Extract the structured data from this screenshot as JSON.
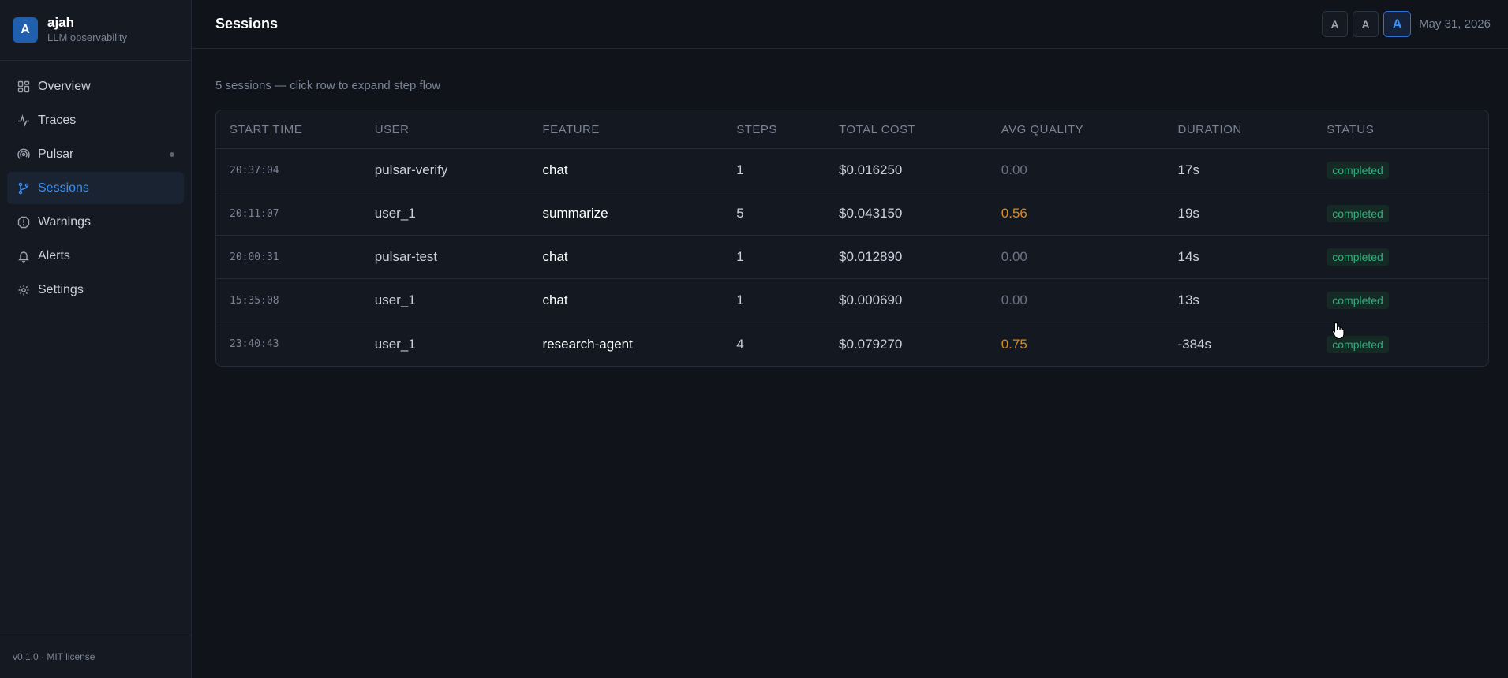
{
  "brand": {
    "initial": "A",
    "name": "ajah",
    "subtitle": "LLM observability"
  },
  "sidebar": {
    "items": [
      {
        "label": "Overview",
        "icon": "grid-icon"
      },
      {
        "label": "Traces",
        "icon": "activity-icon"
      },
      {
        "label": "Pulsar",
        "icon": "radar-icon"
      },
      {
        "label": "Sessions",
        "icon": "branch-icon",
        "active": true
      },
      {
        "label": "Warnings",
        "icon": "octagon-alert-icon"
      },
      {
        "label": "Alerts",
        "icon": "bell-icon"
      },
      {
        "label": "Settings",
        "icon": "gear-icon"
      }
    ],
    "footer": "v0.1.0 · MIT license"
  },
  "header": {
    "title": "Sessions",
    "font_buttons": [
      "A",
      "A",
      "A"
    ],
    "date": "May 31, 2026"
  },
  "main": {
    "summary": "5 sessions — click row to expand step flow",
    "columns": [
      "START TIME",
      "USER",
      "FEATURE",
      "STEPS",
      "TOTAL COST",
      "AVG QUALITY",
      "DURATION",
      "STATUS"
    ],
    "rows": [
      {
        "start": "20:37:04",
        "user": "pulsar-verify",
        "feature": "chat",
        "steps": "1",
        "cost": "$0.016250",
        "quality": "0.00",
        "duration": "17s",
        "status": "completed"
      },
      {
        "start": "20:11:07",
        "user": "user_1",
        "feature": "summarize",
        "steps": "5",
        "cost": "$0.043150",
        "quality": "0.56",
        "duration": "19s",
        "status": "completed"
      },
      {
        "start": "20:00:31",
        "user": "pulsar-test",
        "feature": "chat",
        "steps": "1",
        "cost": "$0.012890",
        "quality": "0.00",
        "duration": "14s",
        "status": "completed"
      },
      {
        "start": "15:35:08",
        "user": "user_1",
        "feature": "chat",
        "steps": "1",
        "cost": "$0.000690",
        "quality": "0.00",
        "duration": "13s",
        "status": "completed"
      },
      {
        "start": "23:40:43",
        "user": "user_1",
        "feature": "research-agent",
        "steps": "4",
        "cost": "$0.079270",
        "quality": "0.75",
        "duration": "-384s",
        "status": "completed"
      }
    ]
  },
  "colors": {
    "accent": "#3b8ef0",
    "warning_quality": "#d98a1f",
    "status_completed": "#2fae7e",
    "background": "#10131a"
  }
}
